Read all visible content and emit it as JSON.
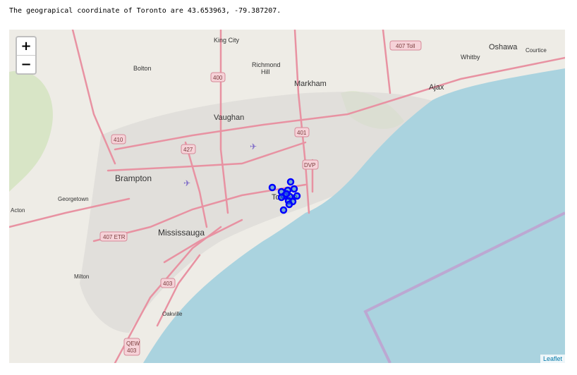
{
  "output": {
    "text": "The geograpical coordinate of Toronto are 43.653963, -79.387207."
  },
  "map": {
    "zoom_in_label": "+",
    "zoom_out_label": "−",
    "attribution": "Leaflet",
    "colors": {
      "land": "#eeece6",
      "water": "#aad3df",
      "major_road": "#e892a2",
      "border": "#c0a0d0",
      "marker_stroke": "#0000ff",
      "marker_fill": "#3186cc"
    },
    "places": [
      {
        "name": "King City"
      },
      {
        "name": "Bolton"
      },
      {
        "name": "Richmond Hill"
      },
      {
        "name": "Markham"
      },
      {
        "name": "Vaughan"
      },
      {
        "name": "Brampton"
      },
      {
        "name": "Georgetown"
      },
      {
        "name": "Acton"
      },
      {
        "name": "Mississauga"
      },
      {
        "name": "Milton"
      },
      {
        "name": "Oakville"
      },
      {
        "name": "Toronto"
      },
      {
        "name": "Whitby"
      },
      {
        "name": "Oshawa"
      },
      {
        "name": "Courtice"
      },
      {
        "name": "Ajax"
      }
    ],
    "shields": [
      {
        "label": "407 Toll"
      },
      {
        "label": "400"
      },
      {
        "label": "410"
      },
      {
        "label": "427"
      },
      {
        "label": "401"
      },
      {
        "label": "DVP"
      },
      {
        "label": "407 ETR"
      },
      {
        "label": "403"
      },
      {
        "label": "QEW 403"
      }
    ],
    "marker_icon": "circle-marker",
    "airport_icon": "airplane-icon"
  }
}
